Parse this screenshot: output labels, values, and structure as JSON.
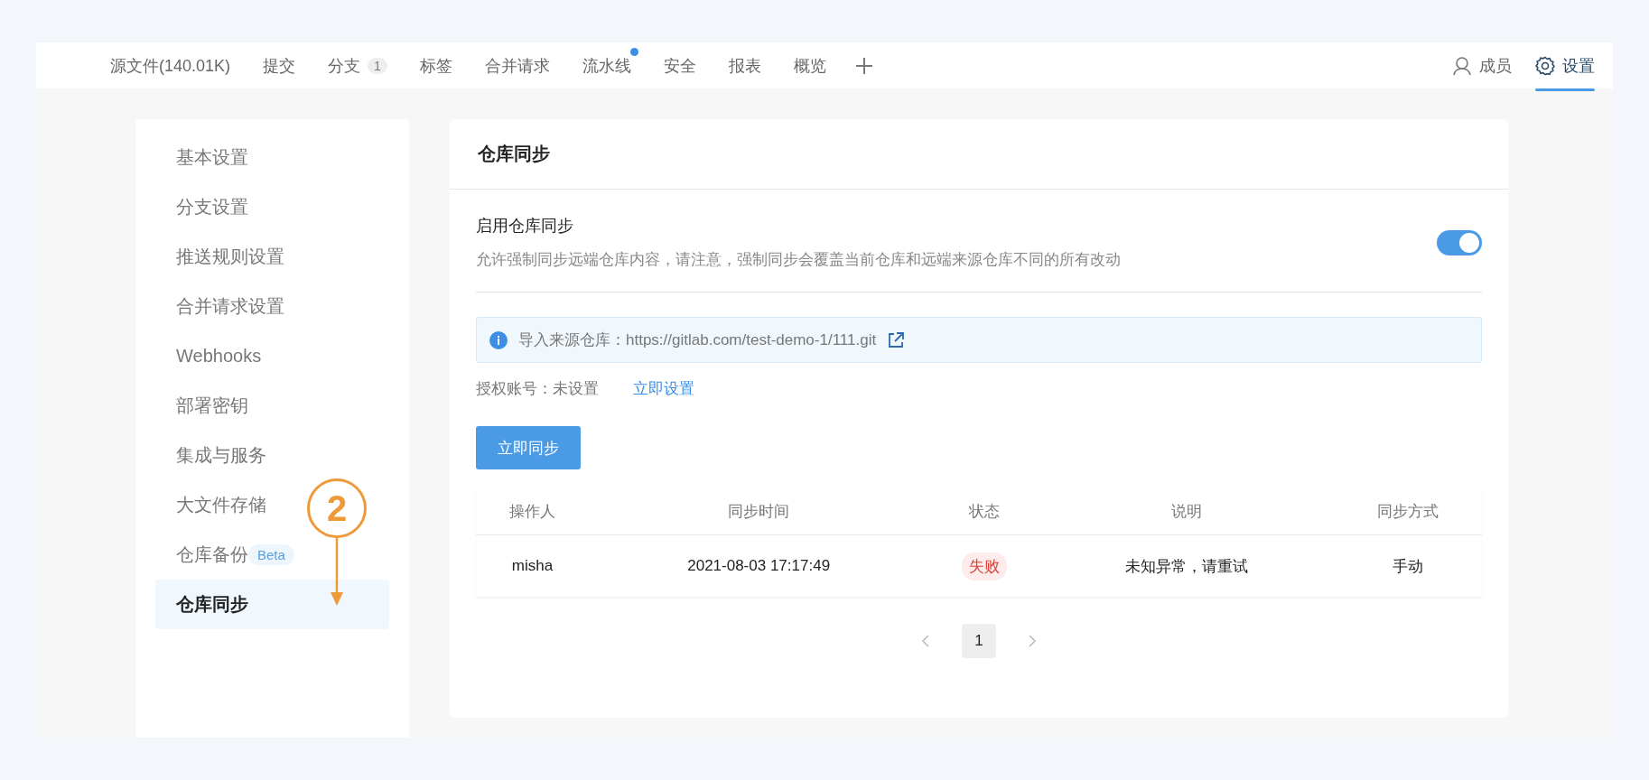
{
  "nav": {
    "tabs": [
      {
        "label": "源文件(140.01K)",
        "selected": false
      },
      {
        "label": "提交",
        "selected": false
      },
      {
        "label": "分支",
        "selected": false,
        "badge": "1"
      },
      {
        "label": "标签",
        "selected": false
      },
      {
        "label": "合并请求",
        "selected": false
      },
      {
        "label": "流水线",
        "selected": false,
        "has_dot": true
      },
      {
        "label": "安全",
        "selected": false
      },
      {
        "label": "报表",
        "selected": false
      },
      {
        "label": "概览",
        "selected": false
      }
    ],
    "right": [
      {
        "kind": "members",
        "label": "成员",
        "selected": false
      },
      {
        "kind": "settings",
        "label": "设置",
        "selected": true
      }
    ]
  },
  "sidebar": {
    "items": [
      {
        "label": "基本设置",
        "selected": false
      },
      {
        "label": "分支设置",
        "selected": false
      },
      {
        "label": "推送规则设置",
        "selected": false
      },
      {
        "label": "合并请求设置",
        "selected": false
      },
      {
        "label": "Webhooks",
        "selected": false
      },
      {
        "label": "部署密钥",
        "selected": false
      },
      {
        "label": "集成与服务",
        "selected": false
      },
      {
        "label": "大文件存储",
        "selected": false
      },
      {
        "label": "仓库备份",
        "selected": false,
        "badge": "Beta"
      },
      {
        "label": "仓库同步",
        "selected": true
      }
    ]
  },
  "panel": {
    "title": "仓库同步",
    "setting": {
      "label": "启用仓库同步",
      "description": "允许强制同步远端仓库内容，请注意，强制同步会覆盖当前仓库和远端来源仓库不同的所有改动",
      "on": true
    },
    "info": {
      "text": "导入来源仓库：https://gitlab.com/test-demo-1/111.git"
    },
    "auth": {
      "label": "授权账号：未设置",
      "link": "立即设置"
    },
    "button": "立即同步",
    "table": {
      "columns": [
        "操作人",
        "同步时间",
        "状态",
        "说明",
        "同步方式"
      ],
      "rows": [
        {
          "operator": "misha",
          "time": "2021-08-03 17:17:49",
          "status": {
            "label": "失败",
            "kind": "failed"
          },
          "note": "未知异常，请重试",
          "method": "手动"
        }
      ]
    },
    "pagination": {
      "prev_disabled": true,
      "next_disabled": true,
      "pages": [
        {
          "label": "1",
          "selected": true
        }
      ]
    }
  },
  "annotation": {
    "step": "2"
  }
}
